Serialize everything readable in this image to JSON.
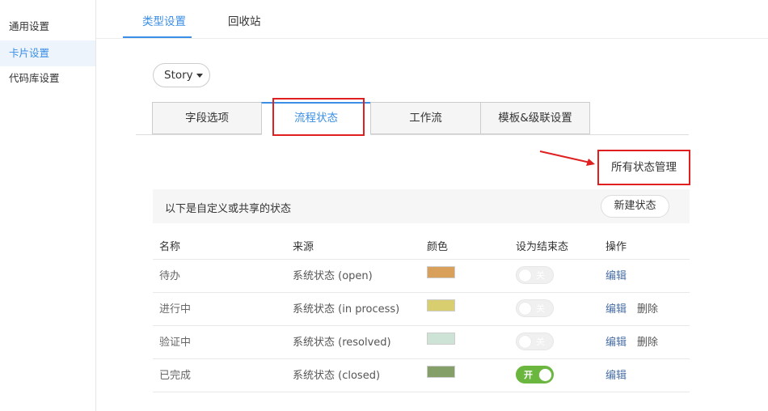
{
  "sidebar": {
    "items": [
      {
        "label": "通用设置"
      },
      {
        "label": "卡片设置"
      },
      {
        "label": "代码库设置"
      }
    ]
  },
  "top_tabs": [
    {
      "label": "类型设置"
    },
    {
      "label": "回收站"
    }
  ],
  "type_selector": {
    "value": "Story"
  },
  "sub_tabs": [
    {
      "label": "字段选项"
    },
    {
      "label": "流程状态"
    },
    {
      "label": "工作流"
    },
    {
      "label": "模板&级联设置"
    }
  ],
  "all_status_button": "所有状态管理",
  "status_bar": {
    "text": "以下是自定义或共享的状态",
    "new_button": "新建状态"
  },
  "table": {
    "headers": [
      "名称",
      "来源",
      "颜色",
      "设为结束态",
      "操作"
    ],
    "rows": [
      {
        "name": "待办",
        "source": "系统状态 (open)",
        "color": "#d9a05b",
        "toggle": "关",
        "edit": "编辑",
        "delete": ""
      },
      {
        "name": "进行中",
        "source": "系统状态 (in process)",
        "color": "#d8cd6f",
        "toggle": "关",
        "edit": "编辑",
        "delete": "删除"
      },
      {
        "name": "验证中",
        "source": "系统状态 (resolved)",
        "color": "#cde3d6",
        "toggle": "关",
        "edit": "编辑",
        "delete": "删除"
      },
      {
        "name": "已完成",
        "source": "系统状态 (closed)",
        "color": "#84a068",
        "toggle": "开",
        "edit": "编辑",
        "delete": ""
      }
    ]
  },
  "colors": {
    "accent": "#3a8ee6",
    "highlight": "#e02020",
    "toggle_on": "#6ab63f"
  }
}
